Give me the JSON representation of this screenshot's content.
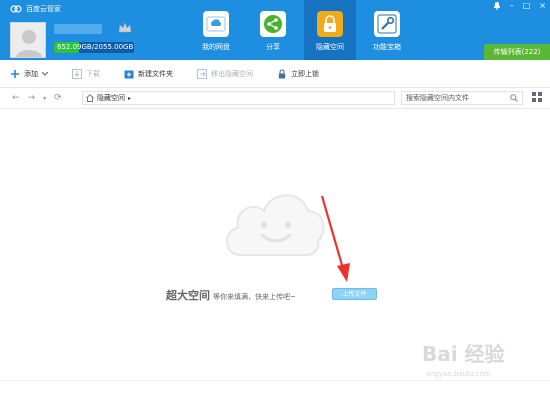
{
  "app": {
    "title": "百度云管家"
  },
  "user": {
    "quota_text": "652.09GB/2055.00GB",
    "quota_used_fraction": 0.317
  },
  "nav": {
    "items": [
      {
        "label": "我的网盘",
        "icon": "cloud-drive-icon",
        "active": false
      },
      {
        "label": "分享",
        "icon": "share-icon",
        "active": false
      },
      {
        "label": "隐藏空间",
        "icon": "lock-icon",
        "active": true
      },
      {
        "label": "功能宝箱",
        "icon": "toolbox-icon",
        "active": false
      }
    ]
  },
  "window_controls": {
    "bell": "bell-icon",
    "minimize": "–",
    "maximize": "□",
    "close": "×"
  },
  "transfer": {
    "label": "传输列表(222)"
  },
  "toolbar": {
    "add": "添加",
    "download": "下载",
    "new_folder": "新建文件夹",
    "move_out": "移出隐藏空间",
    "go_online": "立即上锁"
  },
  "address": {
    "path": "隐藏空间",
    "search_placeholder": "搜索隐藏空间内文件"
  },
  "empty_state": {
    "title": "超大空间",
    "subtitle": "等你来填满，快来上传吧~",
    "upload_button": "上传文件"
  },
  "watermark": {
    "main": "Bai  经验",
    "sub": "jingyan.baidu.com"
  },
  "colors": {
    "header": "#1e8fe0",
    "active_tab": "#1573c2",
    "quota_fill": "#2ec13b",
    "transfer": "#5ab836",
    "upload": "#8fd2f5",
    "arrow": "#e8342b"
  }
}
